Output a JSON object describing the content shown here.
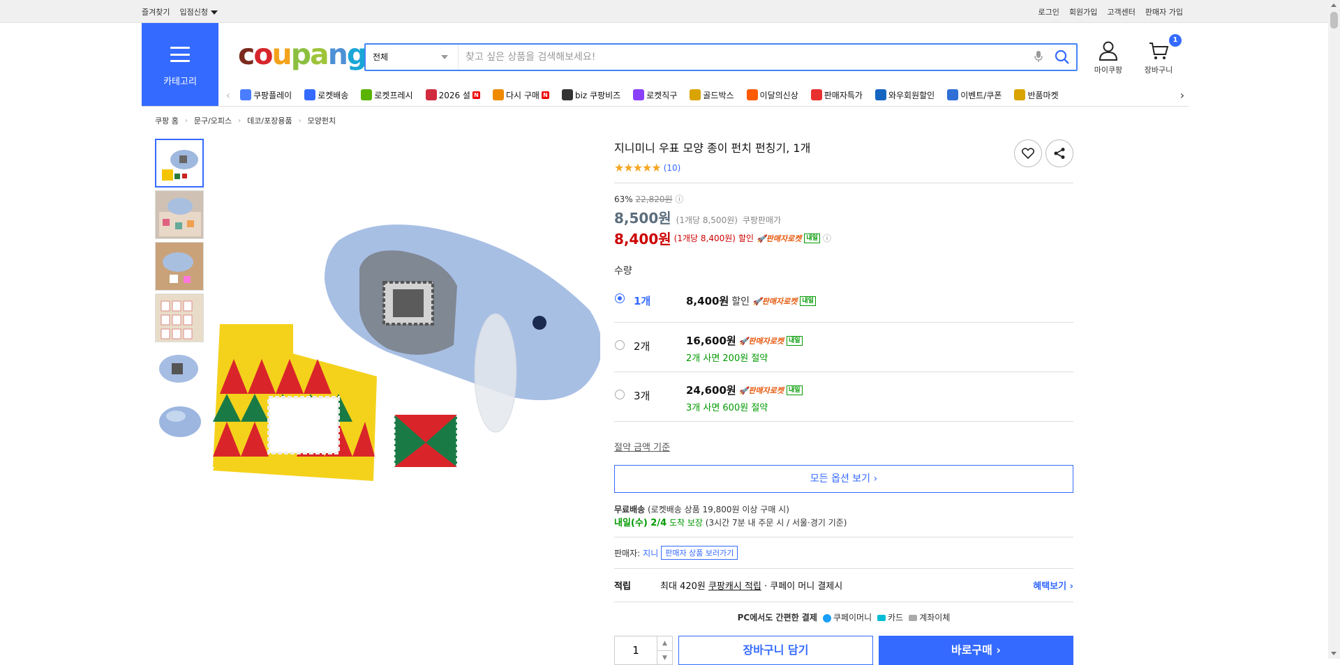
{
  "topbar": {
    "favorites": "즐겨찾기",
    "store_apply": "입점신청",
    "login": "로그인",
    "signup": "회원가입",
    "support": "고객센터",
    "seller_join": "판매자 가입"
  },
  "category": {
    "label": "카테고리"
  },
  "logo": {
    "text": "coupang"
  },
  "search": {
    "scope": "전체",
    "placeholder": "찾고 싶은 상품을 검색해보세요!"
  },
  "header_icons": {
    "mypage": "마이쿠팡",
    "cart": "장바구니",
    "cart_count": "1"
  },
  "gnb": [
    {
      "label": "쿠팡플레이",
      "color": "#4a7dff"
    },
    {
      "label": "로켓배송",
      "color": "#346aff"
    },
    {
      "label": "로켓프레시",
      "color": "#59b300"
    },
    {
      "label": "2026 설",
      "color": "#d12b3f",
      "new": "N"
    },
    {
      "label": "다시 구매",
      "color": "#f08a00",
      "new": "N"
    },
    {
      "label": "biz 쿠팡비즈",
      "color": "#333333"
    },
    {
      "label": "로켓직구",
      "color": "#8a3ffc"
    },
    {
      "label": "골드박스",
      "color": "#d9a300"
    },
    {
      "label": "이달의신상",
      "color": "#ff5a00"
    },
    {
      "label": "판매자특가",
      "color": "#e8302f"
    },
    {
      "label": "와우회원할인",
      "color": "#1565c0"
    },
    {
      "label": "이벤트/쿠폰",
      "color": "#2f6fd6"
    },
    {
      "label": "반품마켓",
      "color": "#d9a300"
    }
  ],
  "breadcrumb": [
    "쿠팡 홈",
    "문구/오피스",
    "데코/포장용품",
    "모양펀치"
  ],
  "product": {
    "title": "지니미니 우표 모양 종이 펀치 펀칭기, 1개",
    "stars": "★★★★★",
    "review_count": "(10)",
    "discount_rate": "63%",
    "original_price": "22,820원",
    "price1": "8,500원",
    "price1_unit": "(1개당 8,500원)",
    "price1_tag": "쿠팡판매가",
    "price2": "8,400원",
    "price2_unit": "(1개당 8,400원)",
    "price2_tag": "할인",
    "rocket_label": "판매자로켓",
    "tomorrow": "내일"
  },
  "qty_label": "수량",
  "options": [
    {
      "qty": "1개",
      "price": "8,400원",
      "tag": "할인",
      "rocket": "판매자로켓",
      "arrival": "내일",
      "save": ""
    },
    {
      "qty": "2개",
      "price": "16,600원",
      "tag": "",
      "rocket": "판매자로켓",
      "arrival": "내일",
      "save": "2개 사면 200원 절약"
    },
    {
      "qty": "3개",
      "price": "24,600원",
      "tag": "",
      "rocket": "판매자로켓",
      "arrival": "내일",
      "save": "3개 사면 600원 절약"
    }
  ],
  "save_standard": "절약 금액 기준",
  "all_options": "모든 옵션 보기 ›",
  "shipping": {
    "free": "무료배송",
    "free_note": "(로켓배송 상품 19,800원 이상 구매 시)",
    "arrival": "내일(수) 2/4",
    "arrival_guarantee": "도착 보장",
    "arrival_note": "(3시간 7분 내 주문 시 / 서울·경기 기준)"
  },
  "seller": {
    "label": "판매자:",
    "name": "지니",
    "link": "판매자 상품 보러가기"
  },
  "reward": {
    "label": "적립",
    "text": "최대 420원",
    "cash": "쿠팡캐시 적립",
    "rest": "· 쿠페이 머니 결제시",
    "link": "혜택보기 ›"
  },
  "pay": {
    "title": "PC에서도 간편한 결제",
    "money": "쿠페이머니",
    "card": "카드",
    "bank": "계좌이체"
  },
  "buy": {
    "qty": "1",
    "cart": "장바구니 담기",
    "now": "바로구매 ›"
  }
}
